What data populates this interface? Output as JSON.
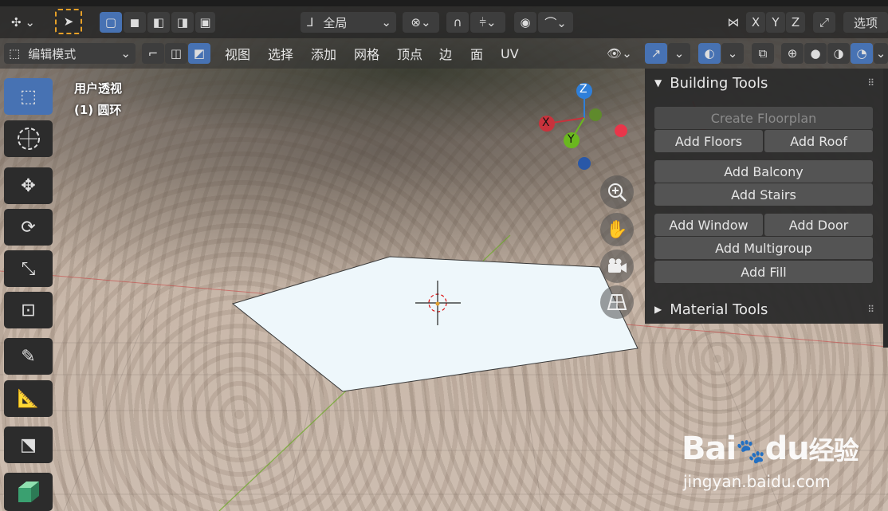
{
  "header": {
    "transform_orientation": "全局",
    "axis_x": "X",
    "axis_y": "Y",
    "axis_z": "Z",
    "options": "选项"
  },
  "mode_bar": {
    "mode": "编辑模式",
    "menus": [
      "视图",
      "选择",
      "添加",
      "网格",
      "顶点",
      "边",
      "面",
      "UV"
    ]
  },
  "viewport": {
    "view_name": "用户透视",
    "object_label": "(1) 圆环",
    "gizmo": {
      "x": "X",
      "y": "Y",
      "z": "Z"
    }
  },
  "panel": {
    "building_tools": {
      "title": "Building Tools",
      "create_floorplan": "Create Floorplan",
      "add_floors": "Add Floors",
      "add_roof": "Add Roof",
      "add_balcony": "Add Balcony",
      "add_stairs": "Add Stairs",
      "add_window": "Add Window",
      "add_door": "Add Door",
      "add_multigroup": "Add Multigroup",
      "add_fill": "Add Fill"
    },
    "material_tools": {
      "title": "Material Tools"
    }
  },
  "watermark": {
    "brand": "Bai",
    "brand2": "du",
    "suffix": "经验",
    "url": "jingyan.baidu.com"
  },
  "colors": {
    "accent": "#4772b3",
    "gizmo_x": "#c8323c",
    "gizmo_y": "#6ab81e",
    "gizmo_z": "#2f7fd9",
    "arrow": "#d01c1c"
  }
}
